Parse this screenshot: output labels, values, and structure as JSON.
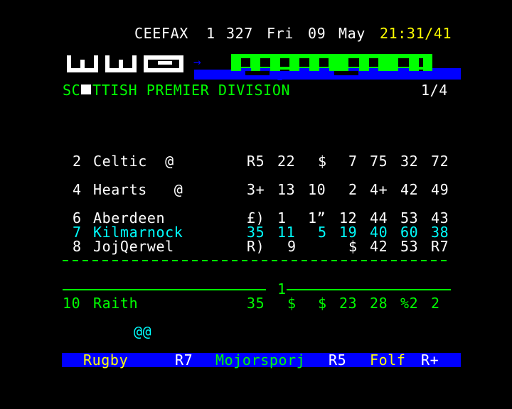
{
  "header": {
    "service": "CEEFAX",
    "channel": "1",
    "page": "327",
    "day": "Fri",
    "date": "09",
    "month": "May",
    "time": "21:31/41"
  },
  "banner": {
    "arrow": "→",
    "marker": "I"
  },
  "section": {
    "title_left": "SC",
    "title_right": "TTISH PREMIER DIVISION",
    "page_count": "1/4"
  },
  "rows": [
    {
      "pos": "2",
      "team": "Celtic  @",
      "c1": "R5",
      "c2": "22",
      "c3": "$",
      "c4": "7",
      "c5": "75",
      "c6": "32",
      "c7": "72"
    },
    {
      "pos": "4",
      "team": "Hearts   @",
      "c1": "3+",
      "c2": "13",
      "c3": "10",
      "c4": "2",
      "c5": "4+",
      "c6": "42",
      "c7": "49"
    },
    {
      "pos": "6",
      "team": "Aberdeen",
      "c1": "£)",
      "c2": "1",
      "c3": "1”",
      "c4": "12",
      "c5": "44",
      "c6": "53",
      "c7": "43"
    },
    {
      "pos": "7",
      "team": "Kilmarnock",
      "c1": "35",
      "c2": "11",
      "c3": "5",
      "c4": "19",
      "c5": "40",
      "c6": "60",
      "c7": "38"
    },
    {
      "pos": "8",
      "team": "JojQerwel",
      "c1": "R)",
      "c2": "9",
      "c3": "",
      "c4": "$",
      "c5": "42",
      "c6": "53",
      "c7": "R7"
    },
    {
      "pos": "10",
      "team": "Raith",
      "c1": "35",
      "c2": "$",
      "c3": "$",
      "c4": "23",
      "c5": "28",
      "c6": "%2",
      "c7": "2"
    }
  ],
  "divider_mark": "1",
  "footer_glyph": "@@",
  "bottom": {
    "item1": "Rugby",
    "page1": "R7",
    "item2": "Mojorsporj",
    "page2": "R5",
    "item3": "Folf",
    "page3": "R+"
  },
  "colors": {
    "background": "#000000",
    "text_white": "#ffffff",
    "text_green": "#00ff00",
    "text_cyan": "#00ffff",
    "text_yellow": "#ffff00",
    "bar_blue": "#0000ff"
  }
}
